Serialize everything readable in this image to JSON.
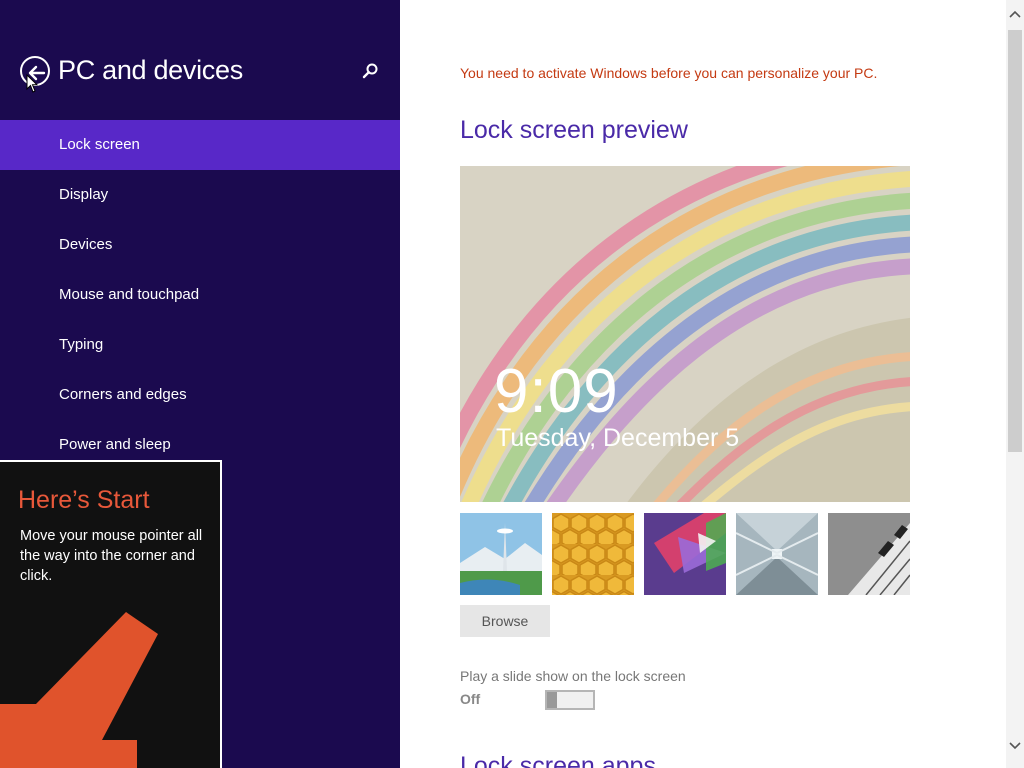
{
  "header": {
    "title": "PC and devices",
    "back_icon": "back-arrow-icon",
    "search_icon": "search-icon"
  },
  "nav": {
    "items": [
      {
        "label": "Lock screen",
        "active": true
      },
      {
        "label": "Display"
      },
      {
        "label": "Devices"
      },
      {
        "label": "Mouse and touchpad"
      },
      {
        "label": "Typing"
      },
      {
        "label": "Corners and edges"
      },
      {
        "label": "Power and sleep"
      }
    ]
  },
  "tip": {
    "title": "Here’s Start",
    "body": "Move your mouse pointer all the way into the corner and click."
  },
  "main": {
    "activation_notice": "You need to activate Windows before you can personalize your PC.",
    "preview_title": "Lock screen preview",
    "preview_time": "9:09",
    "preview_date": "Tuesday, December 5",
    "thumbnails": [
      "space-needle-thumbnail",
      "honeycomb-thumbnail",
      "geometric-shapes-thumbnail",
      "train-tunnel-thumbnail",
      "piano-keys-thumbnail"
    ],
    "browse_label": "Browse",
    "slideshow_label": "Play a slide show on the lock screen",
    "slideshow_state": "Off",
    "slideshow_on": false,
    "next_section_title": "Lock screen apps"
  },
  "colors": {
    "sidebar_bg": "#1b0a4f",
    "sidebar_active": "#5828c8",
    "accent_title": "#4a2aa8",
    "warning_text": "#c43a12",
    "tip_title": "#e8583a"
  }
}
